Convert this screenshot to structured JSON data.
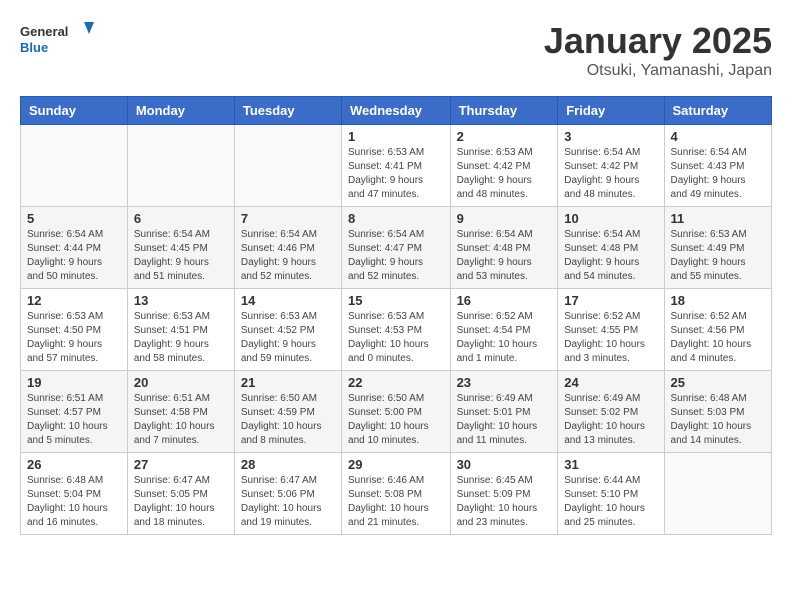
{
  "header": {
    "logo_line1": "General",
    "logo_line2": "Blue",
    "month": "January 2025",
    "location": "Otsuki, Yamanashi, Japan"
  },
  "days_of_week": [
    "Sunday",
    "Monday",
    "Tuesday",
    "Wednesday",
    "Thursday",
    "Friday",
    "Saturday"
  ],
  "weeks": [
    [
      {
        "day": "",
        "info": ""
      },
      {
        "day": "",
        "info": ""
      },
      {
        "day": "",
        "info": ""
      },
      {
        "day": "1",
        "info": "Sunrise: 6:53 AM\nSunset: 4:41 PM\nDaylight: 9 hours\nand 47 minutes."
      },
      {
        "day": "2",
        "info": "Sunrise: 6:53 AM\nSunset: 4:42 PM\nDaylight: 9 hours\nand 48 minutes."
      },
      {
        "day": "3",
        "info": "Sunrise: 6:54 AM\nSunset: 4:42 PM\nDaylight: 9 hours\nand 48 minutes."
      },
      {
        "day": "4",
        "info": "Sunrise: 6:54 AM\nSunset: 4:43 PM\nDaylight: 9 hours\nand 49 minutes."
      }
    ],
    [
      {
        "day": "5",
        "info": "Sunrise: 6:54 AM\nSunset: 4:44 PM\nDaylight: 9 hours\nand 50 minutes."
      },
      {
        "day": "6",
        "info": "Sunrise: 6:54 AM\nSunset: 4:45 PM\nDaylight: 9 hours\nand 51 minutes."
      },
      {
        "day": "7",
        "info": "Sunrise: 6:54 AM\nSunset: 4:46 PM\nDaylight: 9 hours\nand 52 minutes."
      },
      {
        "day": "8",
        "info": "Sunrise: 6:54 AM\nSunset: 4:47 PM\nDaylight: 9 hours\nand 52 minutes."
      },
      {
        "day": "9",
        "info": "Sunrise: 6:54 AM\nSunset: 4:48 PM\nDaylight: 9 hours\nand 53 minutes."
      },
      {
        "day": "10",
        "info": "Sunrise: 6:54 AM\nSunset: 4:48 PM\nDaylight: 9 hours\nand 54 minutes."
      },
      {
        "day": "11",
        "info": "Sunrise: 6:53 AM\nSunset: 4:49 PM\nDaylight: 9 hours\nand 55 minutes."
      }
    ],
    [
      {
        "day": "12",
        "info": "Sunrise: 6:53 AM\nSunset: 4:50 PM\nDaylight: 9 hours\nand 57 minutes."
      },
      {
        "day": "13",
        "info": "Sunrise: 6:53 AM\nSunset: 4:51 PM\nDaylight: 9 hours\nand 58 minutes."
      },
      {
        "day": "14",
        "info": "Sunrise: 6:53 AM\nSunset: 4:52 PM\nDaylight: 9 hours\nand 59 minutes."
      },
      {
        "day": "15",
        "info": "Sunrise: 6:53 AM\nSunset: 4:53 PM\nDaylight: 10 hours\nand 0 minutes."
      },
      {
        "day": "16",
        "info": "Sunrise: 6:52 AM\nSunset: 4:54 PM\nDaylight: 10 hours\nand 1 minute."
      },
      {
        "day": "17",
        "info": "Sunrise: 6:52 AM\nSunset: 4:55 PM\nDaylight: 10 hours\nand 3 minutes."
      },
      {
        "day": "18",
        "info": "Sunrise: 6:52 AM\nSunset: 4:56 PM\nDaylight: 10 hours\nand 4 minutes."
      }
    ],
    [
      {
        "day": "19",
        "info": "Sunrise: 6:51 AM\nSunset: 4:57 PM\nDaylight: 10 hours\nand 5 minutes."
      },
      {
        "day": "20",
        "info": "Sunrise: 6:51 AM\nSunset: 4:58 PM\nDaylight: 10 hours\nand 7 minutes."
      },
      {
        "day": "21",
        "info": "Sunrise: 6:50 AM\nSunset: 4:59 PM\nDaylight: 10 hours\nand 8 minutes."
      },
      {
        "day": "22",
        "info": "Sunrise: 6:50 AM\nSunset: 5:00 PM\nDaylight: 10 hours\nand 10 minutes."
      },
      {
        "day": "23",
        "info": "Sunrise: 6:49 AM\nSunset: 5:01 PM\nDaylight: 10 hours\nand 11 minutes."
      },
      {
        "day": "24",
        "info": "Sunrise: 6:49 AM\nSunset: 5:02 PM\nDaylight: 10 hours\nand 13 minutes."
      },
      {
        "day": "25",
        "info": "Sunrise: 6:48 AM\nSunset: 5:03 PM\nDaylight: 10 hours\nand 14 minutes."
      }
    ],
    [
      {
        "day": "26",
        "info": "Sunrise: 6:48 AM\nSunset: 5:04 PM\nDaylight: 10 hours\nand 16 minutes."
      },
      {
        "day": "27",
        "info": "Sunrise: 6:47 AM\nSunset: 5:05 PM\nDaylight: 10 hours\nand 18 minutes."
      },
      {
        "day": "28",
        "info": "Sunrise: 6:47 AM\nSunset: 5:06 PM\nDaylight: 10 hours\nand 19 minutes."
      },
      {
        "day": "29",
        "info": "Sunrise: 6:46 AM\nSunset: 5:08 PM\nDaylight: 10 hours\nand 21 minutes."
      },
      {
        "day": "30",
        "info": "Sunrise: 6:45 AM\nSunset: 5:09 PM\nDaylight: 10 hours\nand 23 minutes."
      },
      {
        "day": "31",
        "info": "Sunrise: 6:44 AM\nSunset: 5:10 PM\nDaylight: 10 hours\nand 25 minutes."
      },
      {
        "day": "",
        "info": ""
      }
    ]
  ]
}
